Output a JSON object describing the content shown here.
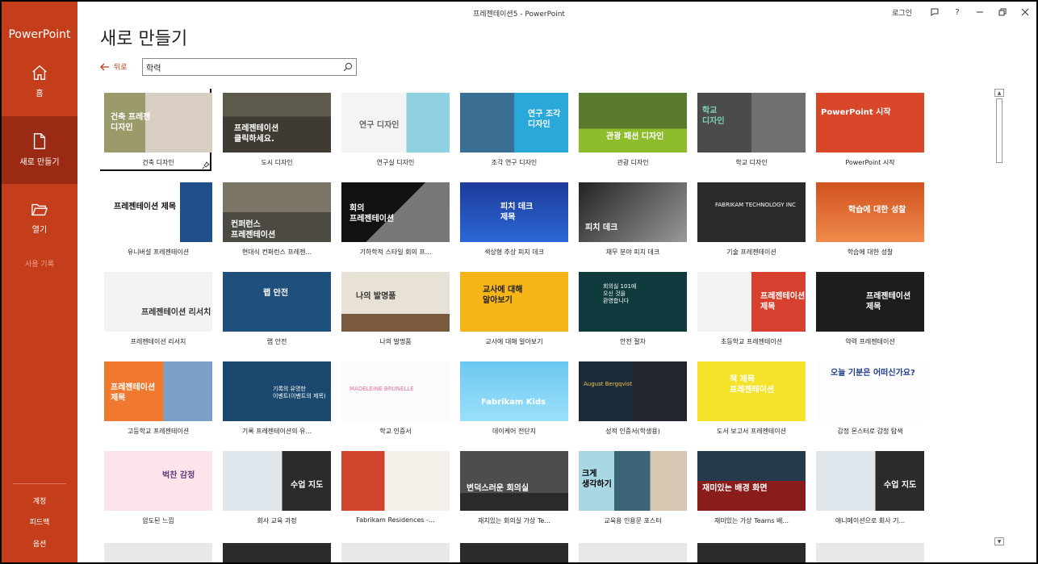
{
  "app": {
    "brand": "PowerPoint",
    "window_title": "프레젠테이션5  -  PowerPoint",
    "sign_in": "로그인"
  },
  "rail": {
    "home": "홈",
    "new": "새로 만들기",
    "open": "열기",
    "recent": "사용 기록",
    "account": "계정",
    "feedback": "피드백",
    "options": "옵션"
  },
  "header": {
    "title": "새로 만들기",
    "back": "뒤로"
  },
  "search": {
    "value": "학력"
  },
  "templates": [
    {
      "label": "건축 디자인",
      "text": "건축 프레젠\n디자인"
    },
    {
      "label": "도시 디자인",
      "text": "프레젠테이션\n클릭하세요."
    },
    {
      "label": "연구실 디자인",
      "text": "연구 디자인"
    },
    {
      "label": "조각 연구 디자인",
      "text": "연구 조각\n디자인"
    },
    {
      "label": "관광 디자인",
      "text": "관광 패션 디자인"
    },
    {
      "label": "학교 디자인",
      "text": "학교\n디자인"
    },
    {
      "label": "PowerPoint 시작",
      "text": "PowerPoint 시작"
    },
    {
      "label": "유니버설 프레젠테이션",
      "text": "프레젠테이션 제목"
    },
    {
      "label": "현대식 컨퍼런스 프레젠...",
      "text": "컨퍼런스\n프레젠테이션"
    },
    {
      "label": "기하학적 스타일 회의 프...",
      "text": "회의\n프레젠테이션"
    },
    {
      "label": "색상형 추상 피치 데크",
      "text": "피치 데크\n제목"
    },
    {
      "label": "채무 분야 피치 데크",
      "text": "피치 데크"
    },
    {
      "label": "기술 프레젠테이션",
      "text": "FABRIKAM TECHNOLOGY INC"
    },
    {
      "label": "학습에 대한 성찰",
      "text": "학습에 대한 성찰"
    },
    {
      "label": "프레젠테이션 리서치",
      "text": "프레젠테이션 리서치"
    },
    {
      "label": "랩 안전",
      "text": "랩 안전"
    },
    {
      "label": "나의 발명품",
      "text": "나의 발명품"
    },
    {
      "label": "교사에 대해 알아보기",
      "text": "교사에 대해\n알아보기"
    },
    {
      "label": "안전 절차",
      "text": "회의실 101에\n오신 것을\n환영합니다"
    },
    {
      "label": "초등학교 프레젠테이션",
      "text": "프레젠테이션\n제목"
    },
    {
      "label": "약력 프레젠테이션",
      "text": "프레젠테이션\n제목"
    },
    {
      "label": "고등학교 프레젠테이션",
      "text": "프레젠테이션\n제목"
    },
    {
      "label": "기록 프레젠테이션의 유...",
      "text": "기록의 유명한\n이벤트(이벤트의 제목)"
    },
    {
      "label": "학교 인증서",
      "text": "MADELEINE BRUNELLE"
    },
    {
      "label": "데이케어 전단지",
      "text": "Fabrikam Kids"
    },
    {
      "label": "성적 인증서(학생용)",
      "text": "August Bergqvist"
    },
    {
      "label": "도서 보고서 프레젠테이션",
      "text": "책 제목\n프레젠테이션"
    },
    {
      "label": "감정 몬스터로 감정 탐색",
      "text": "오늘 기분은 어떠신가요?"
    },
    {
      "label": "압도된 느낌",
      "text": "벅찬 감정"
    },
    {
      "label": "회사 교육 과정",
      "text": "수업 지도"
    },
    {
      "label": "Fabrikam Residences -...",
      "text": ""
    },
    {
      "label": "재치있는 회의실 가상 Te...",
      "text": "변덕스러운 회의실"
    },
    {
      "label": "교육용 인용문 포스터",
      "text": "크게\n생각하기"
    },
    {
      "label": "재미있는 가상 Teams 배...",
      "text": "재미있는 배경 화면"
    },
    {
      "label": "애니메이션으로 회사 기...",
      "text": "수업 지도"
    }
  ],
  "colors": {
    "rail": "#c43e1c",
    "rail_active": "#9b2a14",
    "accent": "#b8381c"
  }
}
